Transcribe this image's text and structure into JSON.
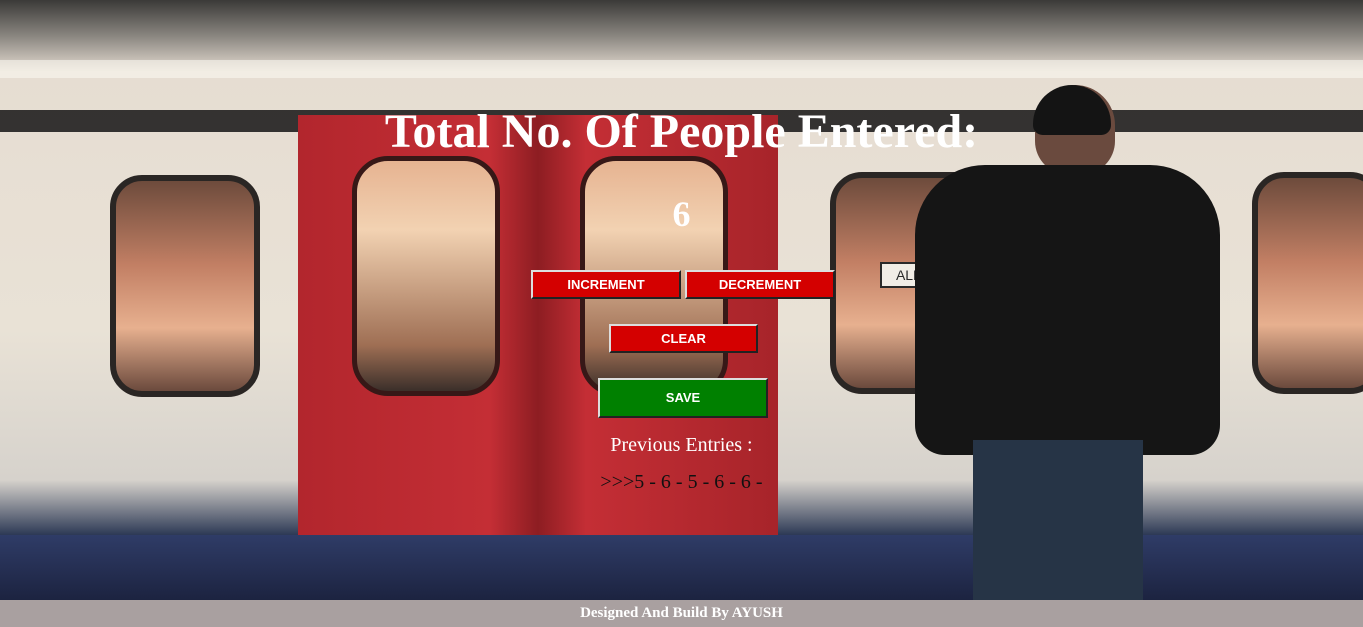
{
  "header": {
    "title": "Total No. Of People Entered:"
  },
  "counter": {
    "value": "6"
  },
  "buttons": {
    "increment_label": "INCREMENT",
    "decrement_label": "DECREMENT",
    "clear_label": "CLEAR",
    "save_label": "SAVE"
  },
  "entries": {
    "label": "Previous Entries :",
    "value": ">>>5 - 6 - 5 - 6 - 6 -"
  },
  "footer": {
    "text": "Designed And Build By AYUSH"
  },
  "background": {
    "sign_text": "ALDG"
  },
  "colors": {
    "action_button": "#d40000",
    "save_button": "#008000",
    "footer_bg": "#a9a0a0",
    "title_text": "#ffffff"
  }
}
